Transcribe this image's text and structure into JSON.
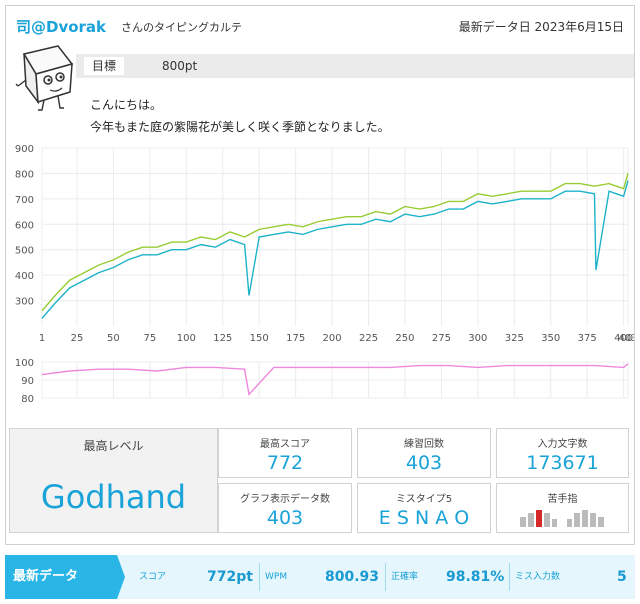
{
  "header": {
    "username": "司@Dvorak",
    "subtitle": "さんのタイピングカルテ",
    "date_label": "最新データ日",
    "date_value": "2023年6月15日"
  },
  "goal": {
    "label": "目標",
    "value": "800pt"
  },
  "greeting": {
    "line1": "こんにちは。",
    "line2": "今年もまた庭の紫陽花が美しく咲く季節となりました。"
  },
  "colors": {
    "accent": "#1aa3d8",
    "score": "#1db3c9",
    "wpm": "#99cc33",
    "accuracy": "#ee88dd"
  },
  "chart_data": {
    "type": "line",
    "x_ticks": [
      "1",
      "25",
      "50",
      "75",
      "100",
      "125",
      "150",
      "175",
      "200",
      "225",
      "250",
      "275",
      "300",
      "325",
      "350",
      "375",
      "400",
      "403"
    ],
    "xlim": [
      1,
      403
    ],
    "top_panel": {
      "ylim": [
        200,
        900
      ],
      "y_ticks": [
        "300",
        "400",
        "500",
        "600",
        "700",
        "800",
        "900"
      ]
    },
    "bottom_panel": {
      "ylim": [
        80,
        100
      ],
      "y_ticks": [
        "80",
        "90",
        "100"
      ]
    },
    "series": [
      {
        "name": "スコア",
        "color": "#1db3c9",
        "x": [
          1,
          10,
          20,
          30,
          40,
          50,
          60,
          70,
          80,
          90,
          100,
          110,
          120,
          130,
          140,
          143,
          150,
          160,
          170,
          180,
          190,
          200,
          210,
          220,
          230,
          240,
          250,
          260,
          270,
          280,
          290,
          300,
          310,
          320,
          330,
          340,
          350,
          360,
          370,
          380,
          381,
          390,
          400,
          403
        ],
        "y": [
          230,
          290,
          350,
          380,
          410,
          430,
          460,
          480,
          480,
          500,
          500,
          520,
          510,
          540,
          520,
          320,
          550,
          560,
          570,
          560,
          580,
          590,
          600,
          600,
          620,
          610,
          640,
          630,
          640,
          660,
          660,
          690,
          680,
          690,
          700,
          700,
          700,
          730,
          730,
          720,
          420,
          730,
          710,
          772
        ]
      },
      {
        "name": "WPM",
        "color": "#99cc33",
        "x": [
          1,
          10,
          20,
          30,
          40,
          50,
          60,
          70,
          80,
          90,
          100,
          110,
          120,
          130,
          140,
          150,
          160,
          170,
          180,
          190,
          200,
          210,
          220,
          230,
          240,
          250,
          260,
          270,
          280,
          290,
          300,
          310,
          320,
          330,
          340,
          350,
          360,
          370,
          380,
          390,
          400,
          403
        ],
        "y": [
          260,
          320,
          380,
          410,
          440,
          460,
          490,
          510,
          510,
          530,
          530,
          550,
          540,
          570,
          550,
          580,
          590,
          600,
          590,
          610,
          620,
          630,
          630,
          650,
          640,
          670,
          660,
          670,
          690,
          690,
          720,
          710,
          720,
          730,
          730,
          730,
          760,
          760,
          750,
          760,
          740,
          801
        ]
      },
      {
        "name": "正確率",
        "color": "#ee88dd",
        "x": [
          1,
          20,
          40,
          60,
          80,
          100,
          120,
          140,
          143,
          160,
          180,
          200,
          220,
          240,
          260,
          280,
          300,
          320,
          340,
          360,
          380,
          400,
          403
        ],
        "y": [
          93,
          95,
          96,
          96,
          95,
          97,
          97,
          96,
          82,
          97,
          97,
          97,
          97,
          97,
          98,
          98,
          97,
          98,
          98,
          98,
          98,
          97,
          99
        ]
      }
    ]
  },
  "stats": {
    "level": {
      "title": "最高レベル",
      "value": "Godhand"
    },
    "best_score": {
      "title": "最高スコア",
      "value": "772"
    },
    "practice_count": {
      "title": "練習回数",
      "value": "403"
    },
    "chars_typed": {
      "title": "入力文字数",
      "value": "173671"
    },
    "graph_points": {
      "title": "グラフ表示データ数",
      "value": "403"
    },
    "miss_types": {
      "title": "ミスタイプ5",
      "value": "E S N A O"
    },
    "weak_finger": {
      "title": "苦手指"
    }
  },
  "latest": {
    "tag": "最新データ",
    "score_label": "スコア",
    "score_value": "772pt",
    "wpm_label": "WPM",
    "wpm_value": "800.93",
    "accuracy_label": "正確率",
    "accuracy_value": "98.81%",
    "miss_label": "ミス入力数",
    "miss_value": "5"
  }
}
